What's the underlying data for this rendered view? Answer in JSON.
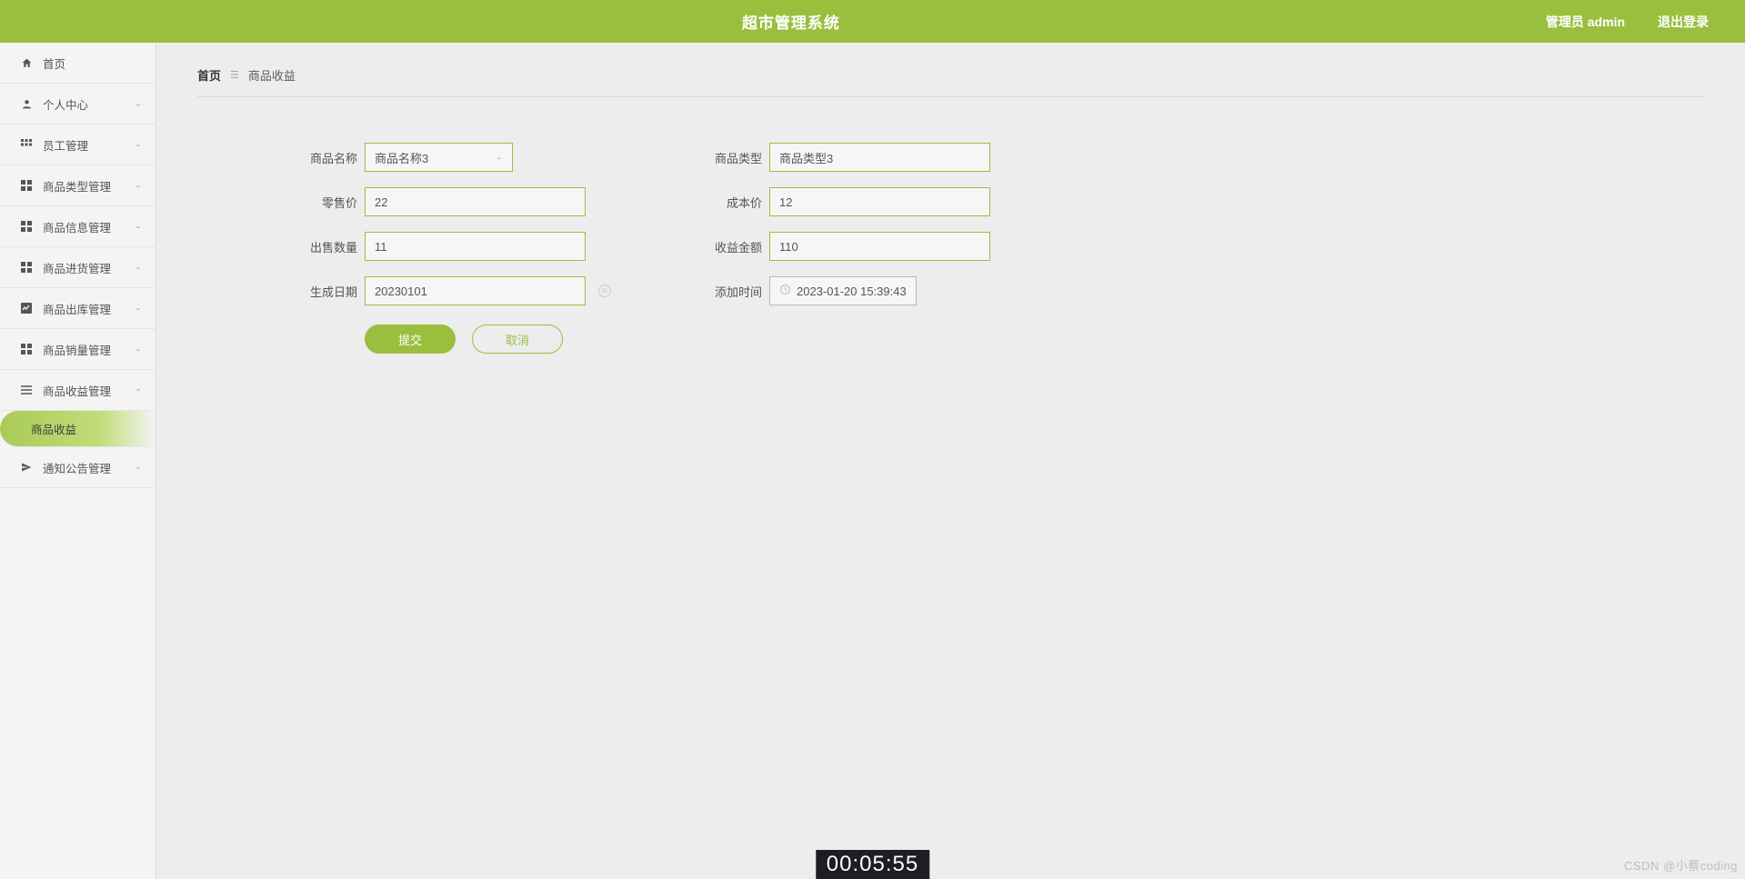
{
  "header": {
    "title": "超市管理系统",
    "user_label": "管理员 admin",
    "logout_label": "退出登录"
  },
  "sidebar": {
    "items": [
      {
        "label": "首页",
        "icon": "home",
        "expandable": false
      },
      {
        "label": "个人中心",
        "icon": "person",
        "expandable": true
      },
      {
        "label": "员工管理",
        "icon": "grid3",
        "expandable": true
      },
      {
        "label": "商品类型管理",
        "icon": "grid2",
        "expandable": true
      },
      {
        "label": "商品信息管理",
        "icon": "grid2",
        "expandable": true
      },
      {
        "label": "商品进货管理",
        "icon": "grid2",
        "expandable": true
      },
      {
        "label": "商品出库管理",
        "icon": "chart",
        "expandable": true
      },
      {
        "label": "商品销量管理",
        "icon": "grid2",
        "expandable": true
      },
      {
        "label": "商品收益管理",
        "icon": "list",
        "expandable": true,
        "open": true
      },
      {
        "label": "通知公告管理",
        "icon": "send",
        "expandable": true
      }
    ],
    "active_sub": "商品收益"
  },
  "breadcrumb": {
    "home": "首页",
    "current": "商品收益"
  },
  "form": {
    "product_name_label": "商品名称",
    "product_name_value": "商品名称3",
    "product_type_label": "商品类型",
    "product_type_value": "商品类型3",
    "retail_price_label": "零售价",
    "retail_price_value": "22",
    "cost_price_label": "成本价",
    "cost_price_value": "12",
    "sold_qty_label": "出售数量",
    "sold_qty_value": "11",
    "profit_amount_label": "收益金额",
    "profit_amount_value": "110",
    "production_date_label": "生成日期",
    "production_date_value": "20230101",
    "add_time_label": "添加时间",
    "add_time_value": "2023-01-20 15:39:43",
    "submit_label": "提交",
    "cancel_label": "取消"
  },
  "footer": {
    "watermark": "CSDN @小蔡coding",
    "timer": "00:05:55"
  }
}
